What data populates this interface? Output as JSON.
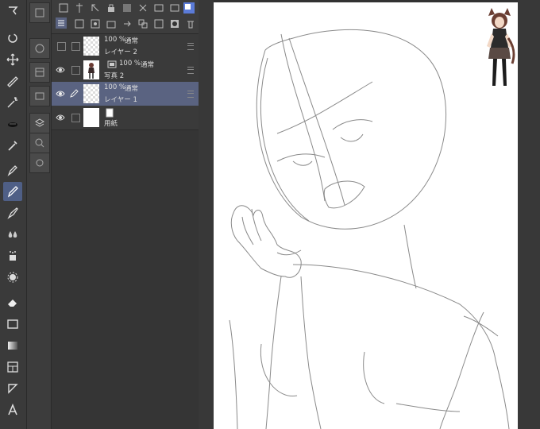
{
  "layers": [
    {
      "opacity": "100 %",
      "blend": "通常",
      "name": "レイヤー 2",
      "visible": false,
      "selected": false,
      "thumb": "checker"
    },
    {
      "opacity": "100 %",
      "blend": "通常",
      "name": "写真 2",
      "visible": true,
      "selected": false,
      "thumb": "photo"
    },
    {
      "opacity": "100 %",
      "blend": "通常",
      "name": "レイヤー 1",
      "visible": true,
      "selected": true,
      "thumb": "checker"
    },
    {
      "opacity": "",
      "blend": "",
      "name": "用紙",
      "visible": true,
      "selected": false,
      "thumb": "paper"
    }
  ],
  "tools": [
    "lasso-icon",
    "rotate-icon",
    "move-icon",
    "autoselect-icon",
    "wand-icon",
    "eyedropper-icon",
    "picker-icon",
    "pen-icon",
    "pencil-icon",
    "brush-icon",
    "blend-icon",
    "airbrush-icon",
    "decoration-icon",
    "eraser-icon",
    "fill-rect-icon",
    "gradient-icon",
    "frame-icon",
    "ruler-icon",
    "text-icon"
  ],
  "colors": {
    "selection": "#5a6381",
    "accent": "#4f5f86",
    "canvas": "#ffffff"
  }
}
